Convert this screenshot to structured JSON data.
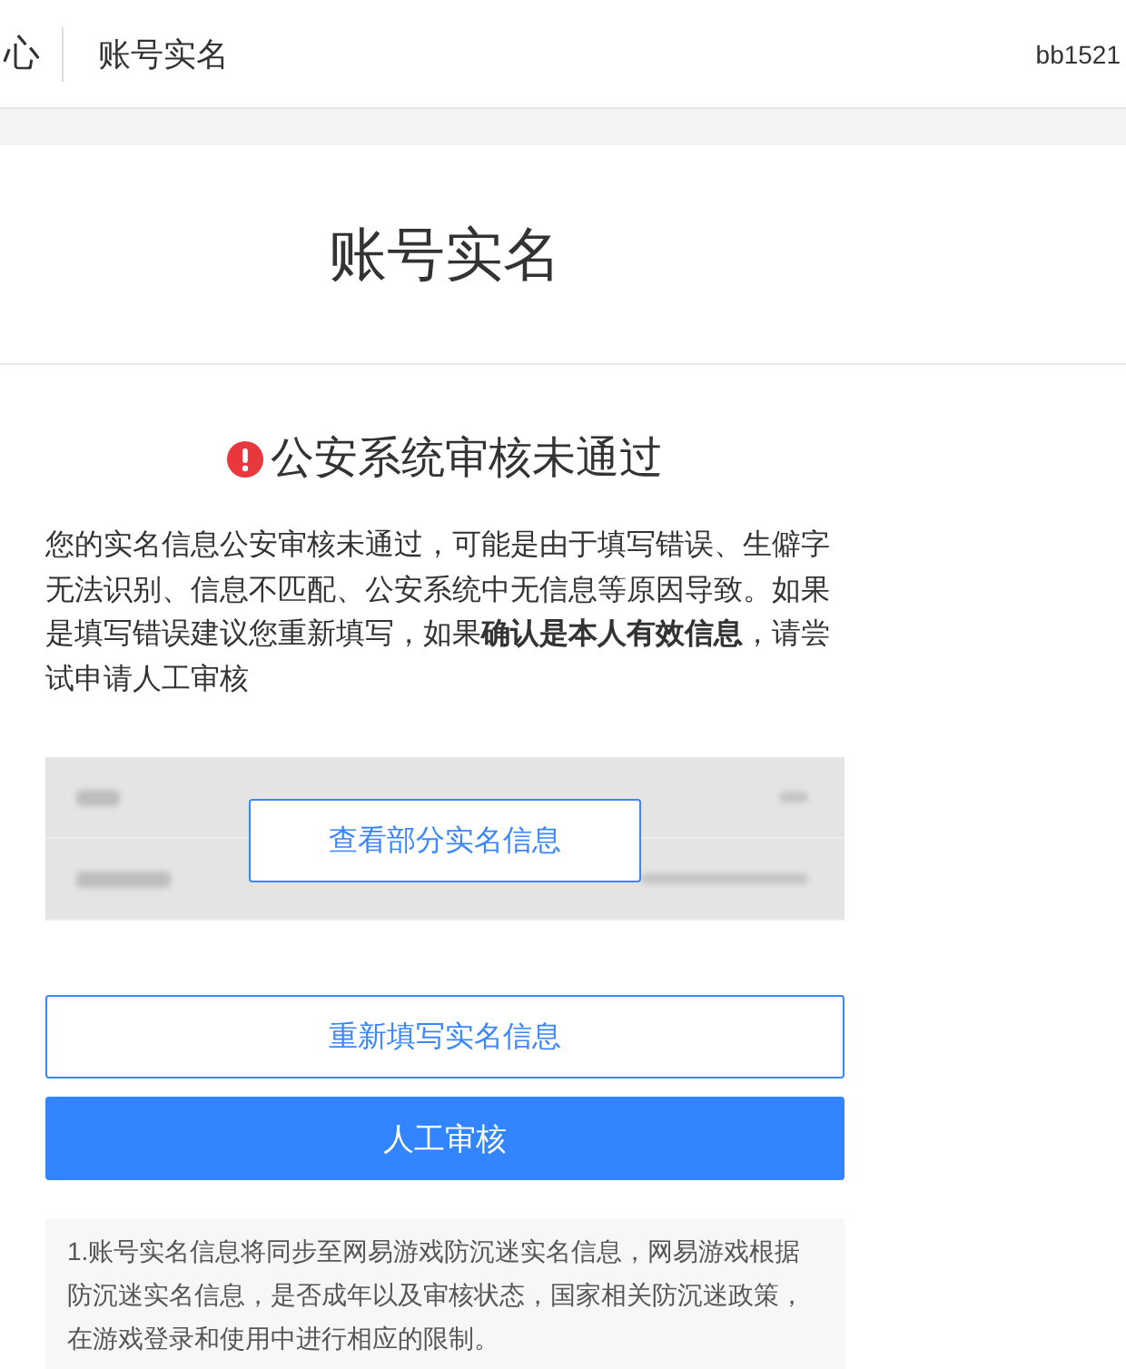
{
  "header": {
    "brand_fragment": "心",
    "title": "账号实名",
    "username": "bb1521"
  },
  "page_title": "账号实名",
  "status": {
    "kind": "error",
    "title": "公安系统审核未通过"
  },
  "message": "您的实名信息公安审核未通过，可能是由于填写错误、生僻字无法识别、信息不匹配、公安系统中无信息等原因导致。如果是填写错误建议您重新填写，如果**确认是本人有效信息**，请尝试申请人工审核",
  "info_panel": {
    "reveal_button": "查看部分实名信息"
  },
  "buttons": [
    {
      "label": "重新填写实名信息",
      "kind": "outline"
    },
    {
      "label": "人工审核",
      "kind": "primary"
    }
  ],
  "notes": [
    "1.账号实名信息将同步至网易游戏防沉迷实名信息，网易游戏根据防沉迷实名信息，是否成年以及审核状态，国家相关防沉迷政策，在游戏登录和使用中进行相应的限制。"
  ]
}
